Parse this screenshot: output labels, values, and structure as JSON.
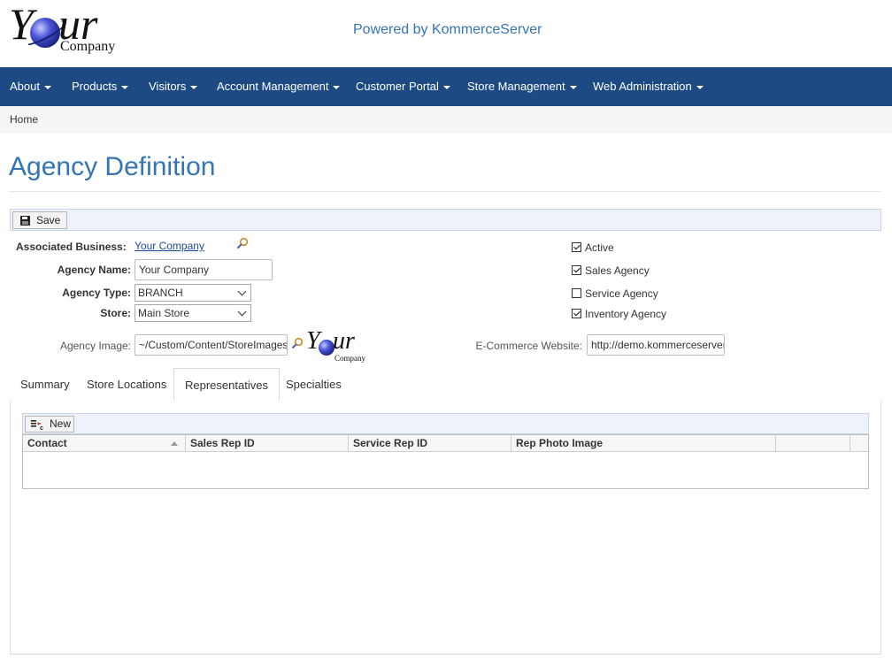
{
  "header": {
    "logo": {
      "main": "Your",
      "sub": "Company"
    },
    "powered_by": "Powered by KommerceServer"
  },
  "nav": {
    "items": [
      {
        "label": "About"
      },
      {
        "label": "Products"
      },
      {
        "label": "Visitors"
      },
      {
        "label": "Account Management"
      },
      {
        "label": "Customer Portal"
      },
      {
        "label": "Store Management"
      },
      {
        "label": "Web Administration"
      }
    ]
  },
  "breadcrumb": {
    "home": "Home"
  },
  "page": {
    "title": "Agency Definition"
  },
  "toolbar": {
    "save_label": "Save"
  },
  "form": {
    "associated_business": {
      "label": "Associated Business:",
      "value": "Your Company"
    },
    "agency_name": {
      "label": "Agency Name:",
      "value": "Your Company"
    },
    "agency_type": {
      "label": "Agency Type:",
      "value": "BRANCH"
    },
    "store": {
      "label": "Store:",
      "value": "Main Store"
    },
    "agency_image": {
      "label": "Agency Image:",
      "value": "~/Custom/Content/StoreImages/"
    },
    "ecommerce_website": {
      "label": "E-Commerce Website:",
      "value": "http://demo.kommerceserver"
    },
    "checkboxes": [
      {
        "label": "Active",
        "checked": true
      },
      {
        "label": "Sales Agency",
        "checked": true
      },
      {
        "label": "Service Agency",
        "checked": false
      },
      {
        "label": "Inventory Agency",
        "checked": true
      }
    ]
  },
  "tabs": [
    {
      "label": "Summary",
      "active": false
    },
    {
      "label": "Store Locations",
      "active": false
    },
    {
      "label": "Representatives",
      "active": true
    },
    {
      "label": "Specialties",
      "active": false
    }
  ],
  "grid": {
    "new_label": "New",
    "columns": [
      {
        "label": "Contact"
      },
      {
        "label": "Sales Rep ID"
      },
      {
        "label": "Service Rep ID"
      },
      {
        "label": "Rep Photo Image"
      },
      {
        "label": ""
      },
      {
        "label": ""
      }
    ],
    "rows": []
  },
  "colors": {
    "navbar": "#1e4a84",
    "accent": "#3575b3",
    "link": "#1e4a9e"
  }
}
